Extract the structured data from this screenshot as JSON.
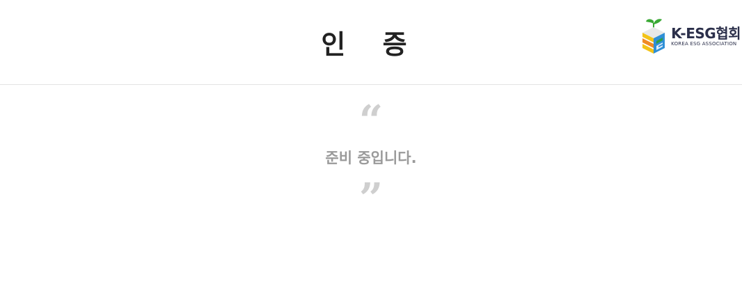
{
  "header": {
    "title": "인 증",
    "logo": {
      "main_text": "K-ESG협회",
      "sub_text": "KOREA ESG ASSOCIATION",
      "colors": {
        "leaf": "#3aa935",
        "yellow": "#f3c318",
        "orange": "#f08a24",
        "blue": "#2f8fd6",
        "green_dark": "#2e9e48",
        "text": "#2b2f4a"
      }
    }
  },
  "notice": {
    "open_quote": "“",
    "message": "준비 중입니다.",
    "close_quote": "”"
  }
}
